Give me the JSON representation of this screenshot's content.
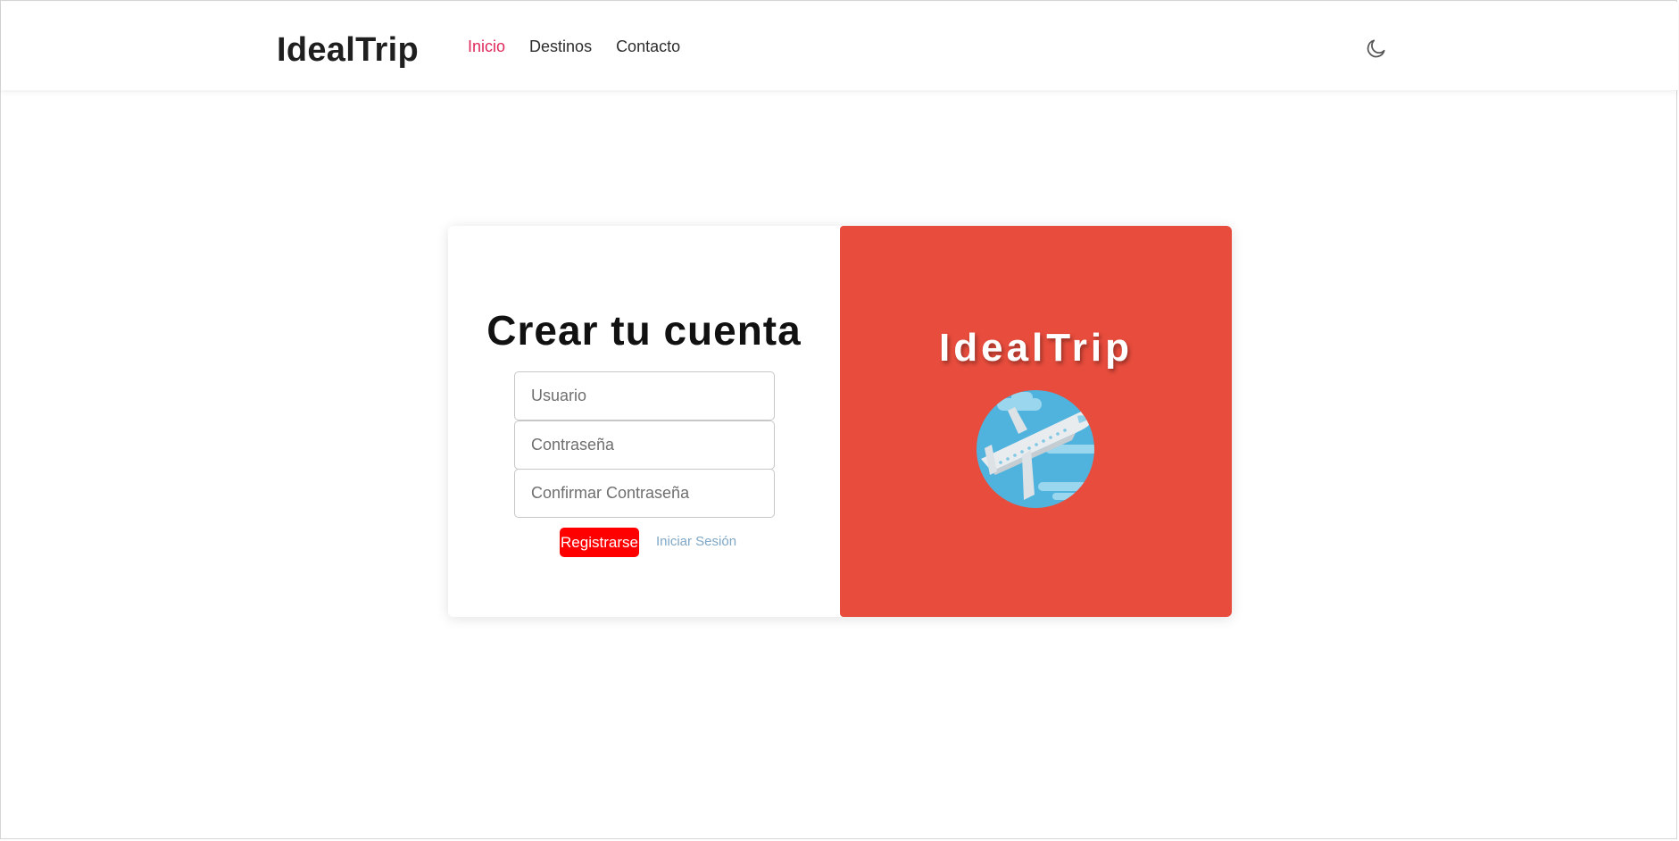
{
  "navbar": {
    "brand": "IdealTrip",
    "links": [
      {
        "label": "Inicio",
        "active": true
      },
      {
        "label": "Destinos",
        "active": false
      },
      {
        "label": "Contacto",
        "active": false
      }
    ],
    "theme_toggle_icon": "moon-icon"
  },
  "register_form": {
    "title": "Crear tu cuenta",
    "username_placeholder": "Usuario",
    "password_placeholder": "Contraseña",
    "confirm_placeholder": "Confirmar Contraseña",
    "submit_label": "Registrarse",
    "login_link": "Iniciar Sesión"
  },
  "brand_panel": {
    "title": "IdealTrip",
    "illustration_icon": "airplane-icon"
  },
  "colors": {
    "accent_red": "#e74c3c",
    "button_red": "#ff0000",
    "active_link": "#e0295c",
    "link_blue": "#7fa7c6"
  }
}
